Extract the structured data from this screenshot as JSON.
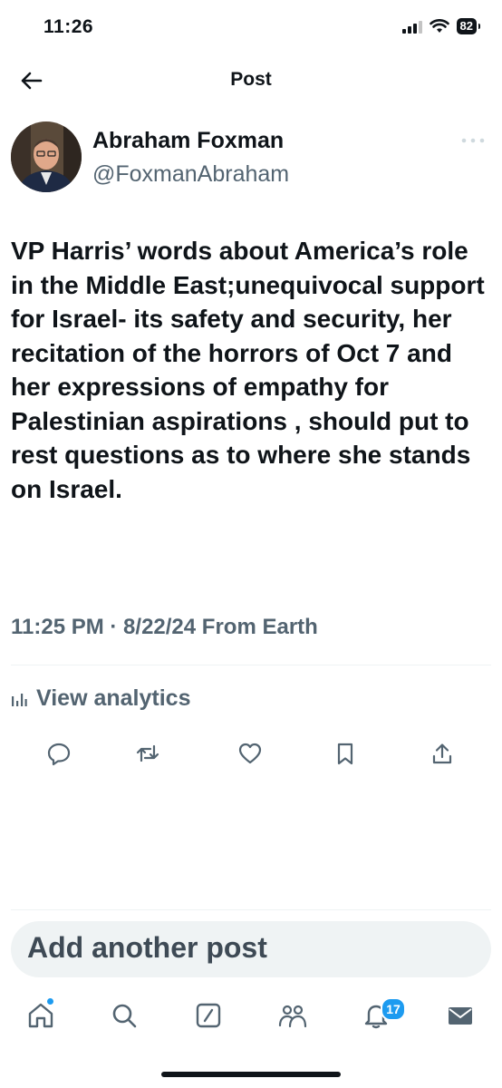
{
  "status_bar": {
    "time": "11:26",
    "battery": "82"
  },
  "header": {
    "title": "Post"
  },
  "author": {
    "name": "Abraham Foxman",
    "handle": "@FoxmanAbraham"
  },
  "post": {
    "text": "VP Harris’ words about America’s role in the Middle East;unequivocal support for Israel- its safety and security, her recitation of the horrors of Oct 7 and her expressions of empathy for Palestinian aspirations , should put to rest questions as to where she stands on Israel.",
    "meta": "11:25 PM · 8/22/24 From Earth"
  },
  "analytics": {
    "label": "View analytics"
  },
  "actions": [
    "reply-icon",
    "repost-icon",
    "like-icon",
    "bookmark-icon",
    "share-icon"
  ],
  "composer": {
    "placeholder": "Add another post"
  },
  "tabbar": {
    "items": [
      "home-icon",
      "search-icon",
      "grok-icon",
      "communities-icon",
      "notifications-icon",
      "messages-icon"
    ],
    "notification_count": "17"
  },
  "colors": {
    "text": "#0f1419",
    "secondary": "#536471",
    "accent": "#1d9bf0"
  }
}
